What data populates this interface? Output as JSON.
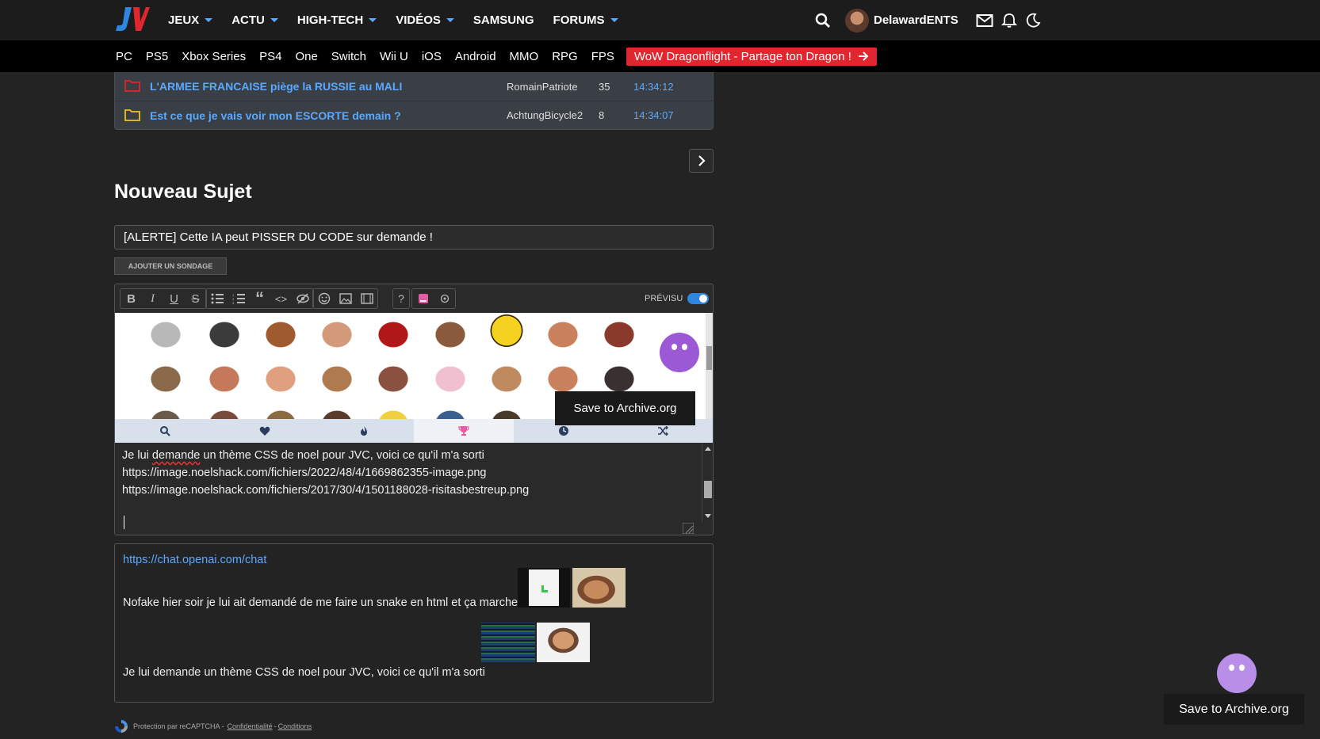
{
  "nav": {
    "items": [
      {
        "label": "JEUX",
        "caret": true
      },
      {
        "label": "ACTU",
        "caret": true
      },
      {
        "label": "HIGH-TECH",
        "caret": true
      },
      {
        "label": "VIDÉOS",
        "caret": true
      },
      {
        "label": "SAMSUNG",
        "caret": false
      },
      {
        "label": "FORUMS",
        "caret": true
      }
    ],
    "username": "DelawardENTS"
  },
  "subnav": {
    "items": [
      "PC",
      "PS5",
      "Xbox Series",
      "PS4",
      "One",
      "Switch",
      "Wii U",
      "iOS",
      "Android",
      "MMO",
      "RPG",
      "FPS"
    ],
    "promo": "WoW Dragonflight - Partage ton Dragon !"
  },
  "topics": [
    {
      "title": "L'ARMEE FRANCAISE piège la RUSSIE au MALI",
      "author": "RomainPatriote",
      "count": "35",
      "time": "14:34:12",
      "folder_color": "#e0262e"
    },
    {
      "title": "Est ce que je vais voir mon ESCORTE demain ?",
      "author": "AchtungBicycle2",
      "count": "8",
      "time": "14:34:07",
      "folder_color": "#f0c419"
    }
  ],
  "form": {
    "heading": "Nouveau Sujet",
    "subject": "[ALERTE] Cette IA peut PISSER DU CODE sur demande !",
    "poll_button": "AJOUTER UN SONDAGE",
    "preview_label": "PRÉVISU",
    "preview_enabled": true
  },
  "editor": {
    "line1_misspelled": "demande",
    "line1_before": "Je lui ",
    "line1_after": " un thème CSS de noel pour JVC, voici ce qu'il m'a sorti",
    "line2": "https://image.noelshack.com/fichiers/2022/48/4/1669862355-image.png",
    "line3": "https://image.noelshack.com/fichiers/2017/30/4/1501188028-risitasbestreup.png"
  },
  "preview": {
    "link": "https://chat.openai.com/chat",
    "line1": "Nofake hier soir je lui ait demandé de me faire un snake en html et ça marche",
    "line2": "Je lui demande un thème CSS de noel pour JVC, voici ce qu'il m'a sorti"
  },
  "captcha": {
    "text": "Protection par reCAPTCHA -",
    "privacy": "Confidentialité",
    "sep": "-",
    "terms": "Conditions"
  },
  "archive": {
    "tooltip": "Save to Archive.org",
    "button": "Save to Archive.org"
  }
}
